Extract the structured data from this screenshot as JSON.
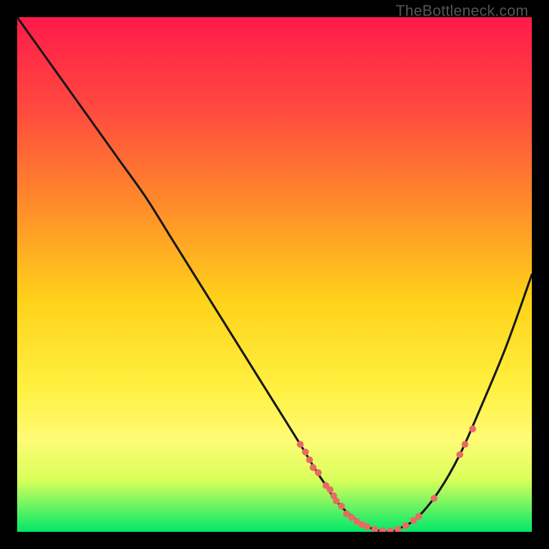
{
  "watermark": "TheBottleneck.com",
  "colors": {
    "gradient_top": "#ff1a4a",
    "gradient_bottom": "#00e86a",
    "curve": "#181818",
    "dots": "#e86a63",
    "frame": "#000000"
  },
  "chart_data": {
    "type": "line",
    "title": "",
    "xlabel": "",
    "ylabel": "",
    "xlim": [
      0,
      100
    ],
    "ylim": [
      0,
      100
    ],
    "annotations": [
      "TheBottleneck.com"
    ],
    "series": [
      {
        "name": "bottleneck-curve",
        "x": [
          0,
          5,
          10,
          15,
          20,
          25,
          30,
          35,
          40,
          45,
          50,
          55,
          58,
          60,
          62,
          65,
          68,
          72,
          75,
          78,
          82,
          86,
          90,
          95,
          100
        ],
        "y": [
          100,
          93,
          86,
          79,
          72,
          65,
          57,
          49,
          41,
          33,
          25,
          17,
          12,
          9,
          6,
          3,
          1,
          0,
          1,
          3,
          8,
          15,
          24,
          36,
          50
        ]
      }
    ],
    "markers": [
      {
        "x": 55.0,
        "y": 17.0,
        "r": 5
      },
      {
        "x": 56.0,
        "y": 15.5,
        "r": 5
      },
      {
        "x": 56.8,
        "y": 14.0,
        "r": 5
      },
      {
        "x": 57.5,
        "y": 12.5,
        "r": 5
      },
      {
        "x": 58.5,
        "y": 11.5,
        "r": 5
      },
      {
        "x": 60.0,
        "y": 9.0,
        "r": 5
      },
      {
        "x": 60.8,
        "y": 8.2,
        "r": 5
      },
      {
        "x": 61.5,
        "y": 7.0,
        "r": 5
      },
      {
        "x": 62.0,
        "y": 6.0,
        "r": 5
      },
      {
        "x": 63.0,
        "y": 5.0,
        "r": 5
      },
      {
        "x": 64.0,
        "y": 3.5,
        "r": 5
      },
      {
        "x": 65.0,
        "y": 2.8,
        "r": 5
      },
      {
        "x": 66.0,
        "y": 2.0,
        "r": 5
      },
      {
        "x": 67.0,
        "y": 1.4,
        "r": 5
      },
      {
        "x": 68.0,
        "y": 1.0,
        "r": 5
      },
      {
        "x": 69.5,
        "y": 0.5,
        "r": 5
      },
      {
        "x": 71.0,
        "y": 0.2,
        "r": 5
      },
      {
        "x": 72.5,
        "y": 0.2,
        "r": 5
      },
      {
        "x": 74.0,
        "y": 0.5,
        "r": 5
      },
      {
        "x": 75.5,
        "y": 1.2,
        "r": 5
      },
      {
        "x": 77.0,
        "y": 2.2,
        "r": 5
      },
      {
        "x": 78.0,
        "y": 3.0,
        "r": 5
      },
      {
        "x": 81.0,
        "y": 6.5,
        "r": 5
      },
      {
        "x": 86.0,
        "y": 15.0,
        "r": 5
      },
      {
        "x": 87.0,
        "y": 17.0,
        "r": 5
      },
      {
        "x": 88.5,
        "y": 20.0,
        "r": 5
      }
    ]
  }
}
